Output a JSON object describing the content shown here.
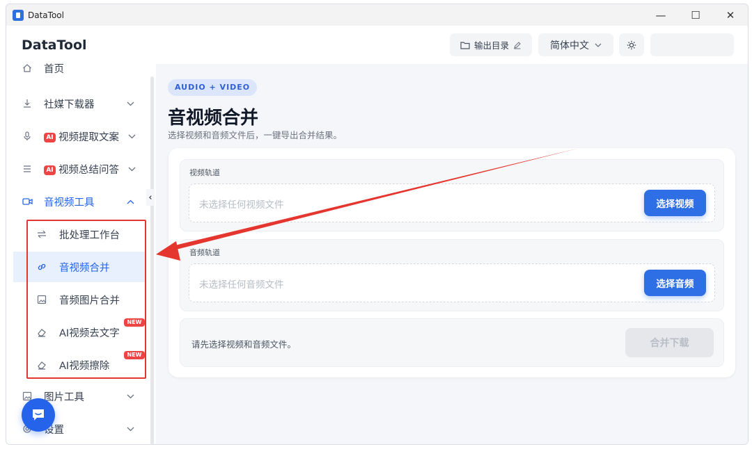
{
  "window": {
    "title": "DataTool",
    "controls": {
      "minimize": "—",
      "maximize": "☐",
      "close": "✕"
    }
  },
  "header": {
    "brand": "DataTool",
    "output_label": "输出目录",
    "language": "简体中文"
  },
  "sidebar": {
    "items": [
      {
        "label": "首页",
        "icon": "home-icon"
      },
      {
        "label": "社媒下载器",
        "icon": "download-icon"
      },
      {
        "label": "视频提取文案",
        "icon": "microphone-icon",
        "badge": "AI"
      },
      {
        "label": "视频总结问答",
        "icon": "list-icon",
        "badge": "AI"
      },
      {
        "label": "音视频工具",
        "icon": "video-icon"
      },
      {
        "label": "图片工具",
        "icon": "image-icon"
      },
      {
        "label": "设置",
        "icon": "settings-icon"
      }
    ],
    "subitems": [
      {
        "label": "批处理工作台",
        "icon": "swap-icon"
      },
      {
        "label": "音视频合并",
        "icon": "link-icon"
      },
      {
        "label": "音频图片合并",
        "icon": "image-icon"
      },
      {
        "label": "AI视频去文字",
        "icon": "eraser-icon",
        "badge": "NEW"
      },
      {
        "label": "AI视频擦除",
        "icon": "eraser-icon",
        "badge": "NEW"
      }
    ],
    "collapse_glyph": "‹"
  },
  "main": {
    "chip": "AUDIO + VIDEO",
    "title": "音视频合并",
    "subtitle": "选择视频和音频文件后，一键导出合并结果。",
    "video_track": {
      "label": "视频轨道",
      "placeholder": "未选择任何视频文件",
      "button": "选择视频"
    },
    "audio_track": {
      "label": "音频轨道",
      "placeholder": "未选择任何音频文件",
      "button": "选择音频"
    },
    "status": "请先选择视频和音频文件。",
    "merge_button": "合并下载"
  },
  "colors": {
    "accent": "#2f6fe6",
    "chip_bg": "#dbe6fc",
    "annotation_red": "#e5352f",
    "badge_red": "#ef4444"
  }
}
